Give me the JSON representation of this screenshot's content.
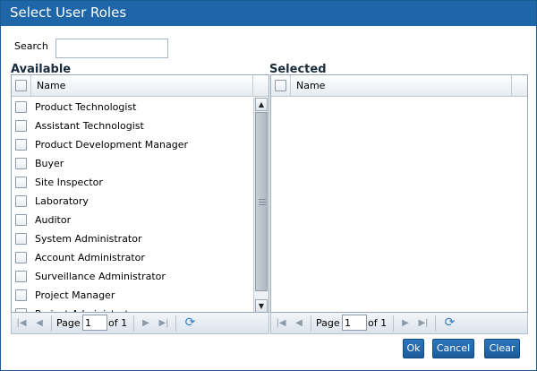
{
  "dialog": {
    "title": "Select User Roles"
  },
  "search": {
    "label": "Search",
    "value": "",
    "placeholder": ""
  },
  "available": {
    "title": "Available",
    "column_name": "Name",
    "rows": [
      "Product Technologist",
      "Assistant Technologist",
      "Product Development Manager",
      "Buyer",
      "Site Inspector",
      "Laboratory",
      "Auditor",
      "System Administrator",
      "Account Administrator",
      "Surveillance Administrator",
      "Project Manager",
      "Project Administrator"
    ],
    "pager": {
      "page_label": "Page",
      "page_value": "1",
      "of_label": "of 1"
    }
  },
  "selected": {
    "title": "Selected",
    "column_name": "Name",
    "rows": [],
    "pager": {
      "page_label": "Page",
      "page_value": "1",
      "of_label": "of 1"
    }
  },
  "buttons": {
    "ok": "Ok",
    "cancel": "Cancel",
    "clear": "Clear"
  },
  "icons": {
    "first_page": "first-page-icon",
    "prev_page": "prev-page-icon",
    "next_page": "next-page-icon",
    "last_page": "last-page-icon",
    "refresh": "refresh-icon"
  },
  "colors": {
    "titlebar": "#1f66a8",
    "button": "#1c5c9c",
    "refresh": "#2f7fc8"
  }
}
